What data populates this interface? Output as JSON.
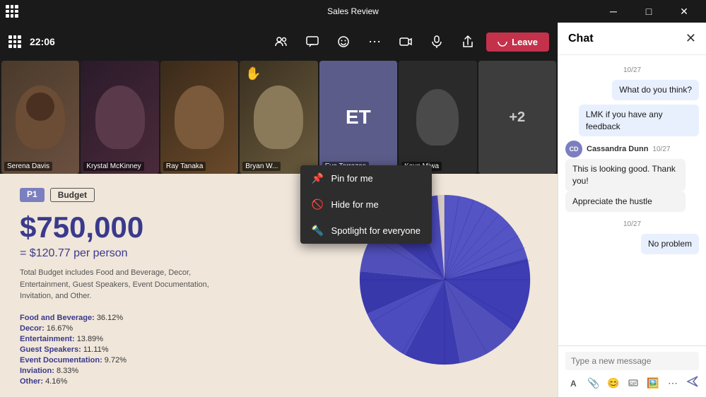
{
  "titleBar": {
    "title": "Sales Review",
    "minBtn": "─",
    "maxBtn": "□",
    "closeBtn": "✕"
  },
  "toolbar": {
    "time": "22:06",
    "leaveLabel": "Leave"
  },
  "participants": [
    {
      "id": "serena",
      "name": "Serena Davis",
      "type": "video",
      "bgColor": "#3a3a3a"
    },
    {
      "id": "krystal",
      "name": "Krystal McKinney",
      "type": "video",
      "bgColor": "#2a2a2a"
    },
    {
      "id": "ray",
      "name": "Ray Tanaka",
      "type": "video",
      "bgColor": "#4a4a4a"
    },
    {
      "id": "bryan",
      "name": "Bryan W...",
      "type": "video",
      "bgColor": "#6b5c3e",
      "raiseHand": true
    },
    {
      "id": "eva",
      "name": "Eva Terrazas",
      "type": "initials",
      "initials": "ET",
      "bgColor": "#5c5c8a"
    },
    {
      "id": "kayo",
      "name": "Kayo Miwa",
      "type": "video",
      "bgColor": "#2d2d2d"
    },
    {
      "id": "plus",
      "name": "+2",
      "type": "plus"
    }
  ],
  "contextMenu": {
    "items": [
      {
        "id": "pin",
        "icon": "📌",
        "label": "Pin for me"
      },
      {
        "id": "hide",
        "icon": "🚫",
        "label": "Hide for me"
      },
      {
        "id": "spotlight",
        "icon": "🔦",
        "label": "Spotlight for everyone"
      }
    ]
  },
  "slide": {
    "tag1": "P1",
    "tag2": "Budget",
    "amount": "$750,000",
    "perPerson": "= $120.77 per person",
    "description": "Total Budget includes Food and Beverage, Decor, Entertainment, Guest Speakers, Event Documentation, Invitation, and Other.",
    "breakdown": [
      {
        "label": "Food and Beverage:",
        "value": "36.12%"
      },
      {
        "label": "Decor:",
        "value": "16.67%"
      },
      {
        "label": "Entertainment:",
        "value": "13.89%"
      },
      {
        "label": "Guest Speakers:",
        "value": "11.11%"
      },
      {
        "label": "Event Documentation:",
        "value": "9.72%"
      },
      {
        "label": "Inviation:",
        "value": "8.33%"
      },
      {
        "label": "Other:",
        "value": "4.16%"
      }
    ]
  },
  "chat": {
    "title": "Chat",
    "messages": [
      {
        "type": "date",
        "text": "10/27"
      },
      {
        "type": "sent",
        "text": "What do you think?"
      },
      {
        "type": "sent",
        "text": "LMK if you have any feedback"
      },
      {
        "type": "received",
        "sender": "Cassandra Dunn",
        "time": "10/27",
        "bubbles": [
          "This is looking good. Thank you!",
          "Appreciate the hustle"
        ]
      },
      {
        "type": "date",
        "text": "10/27"
      },
      {
        "type": "sent",
        "text": "No problem"
      }
    ],
    "inputPlaceholder": "Type a new message",
    "toolbarIcons": [
      "✏️",
      "📎",
      "😊",
      "📷",
      "🖼️",
      "⋯"
    ]
  }
}
